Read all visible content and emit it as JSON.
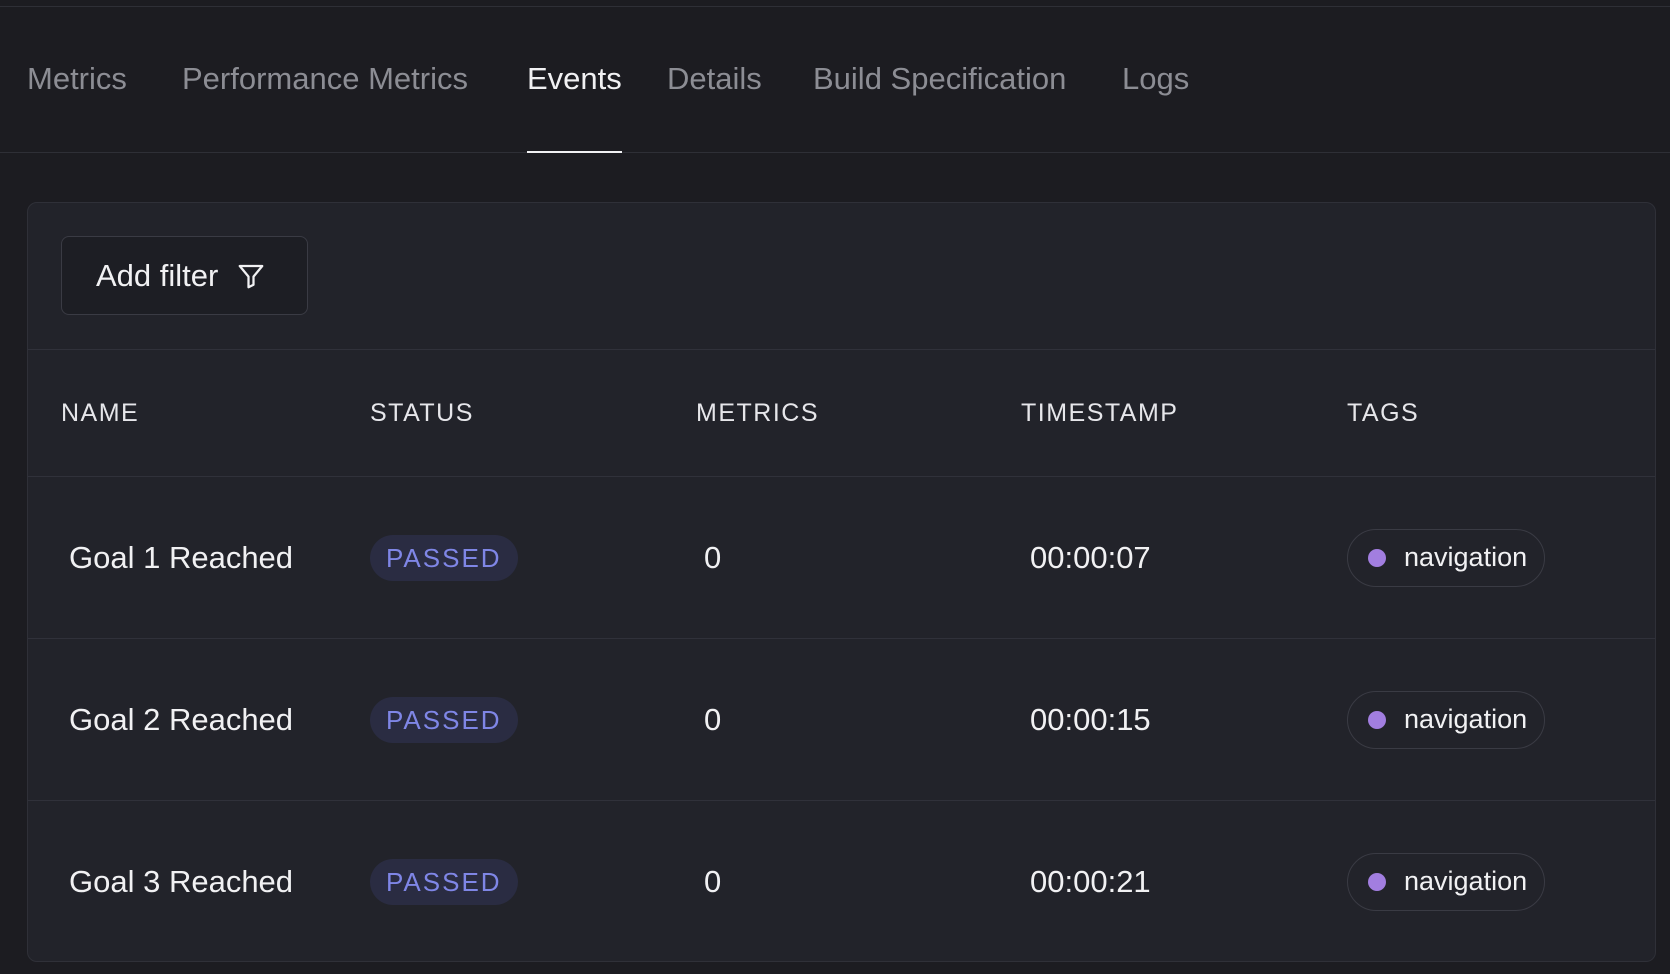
{
  "tabs": [
    {
      "label": "Metrics"
    },
    {
      "label": "Performance Metrics"
    },
    {
      "label": "Events"
    },
    {
      "label": "Details"
    },
    {
      "label": "Build Specification"
    },
    {
      "label": "Logs"
    }
  ],
  "active_tab": "Events",
  "toolbar": {
    "add_filter_label": "Add filter",
    "filter_icon": "filter-funnel-icon"
  },
  "table": {
    "columns": [
      "NAME",
      "STATUS",
      "METRICS",
      "TIMESTAMP",
      "TAGS"
    ],
    "rows": [
      {
        "name": "Goal 1 Reached",
        "status": "PASSED",
        "metrics": "0",
        "timestamp": "00:00:07",
        "tag": "navigation"
      },
      {
        "name": "Goal 2 Reached",
        "status": "PASSED",
        "metrics": "0",
        "timestamp": "00:00:15",
        "tag": "navigation"
      },
      {
        "name": "Goal 3 Reached",
        "status": "PASSED",
        "metrics": "0",
        "timestamp": "00:00:21",
        "tag": "navigation"
      }
    ]
  },
  "colors": {
    "background": "#1c1c21",
    "panel": "#22232a",
    "status_passed_text": "#7f86e6",
    "status_passed_bg": "#2a2c42",
    "tag_dot": "#a27ee0"
  }
}
